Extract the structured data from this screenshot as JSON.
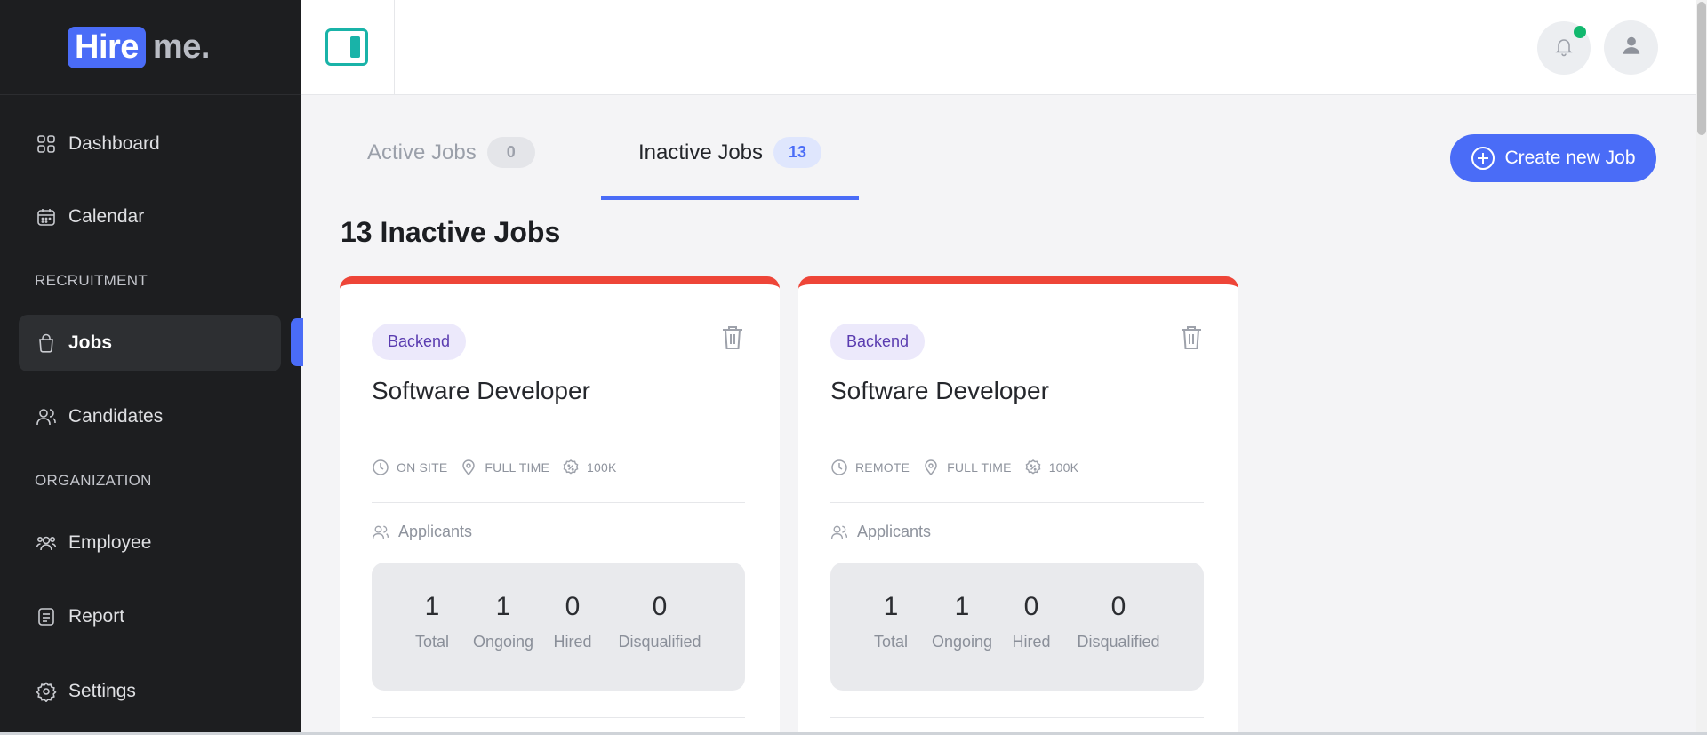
{
  "logo": {
    "part1": "Hire",
    "part2": "me."
  },
  "sidebar": {
    "items": [
      {
        "label": "Dashboard",
        "icon": "grid-icon"
      },
      {
        "label": "Calendar",
        "icon": "calendar-icon"
      },
      {
        "label": "Jobs",
        "icon": "briefcase-icon",
        "active": true
      },
      {
        "label": "Candidates",
        "icon": "users-icon"
      },
      {
        "label": "Employee",
        "icon": "employee-group-icon"
      },
      {
        "label": "Report",
        "icon": "report-icon"
      },
      {
        "label": "Settings",
        "icon": "gear-icon"
      }
    ],
    "sections": {
      "recruitment": "RECRUITMENT",
      "organization": "ORGANIZATION"
    }
  },
  "tabs": [
    {
      "label": "Active Jobs",
      "count": "0"
    },
    {
      "label": "Inactive Jobs",
      "count": "13",
      "active": true
    }
  ],
  "actions": {
    "create_label": "Create new Job"
  },
  "main": {
    "title": "13 Inactive Jobs"
  },
  "cards": [
    {
      "badge": "Backend",
      "title": "Software Developer",
      "meta": {
        "location": "ON SITE",
        "type": "FULL TIME",
        "salary": "100K"
      },
      "applicants_label": "Applicants",
      "stats": [
        {
          "value": "1",
          "label": "Total"
        },
        {
          "value": "1",
          "label": "Ongoing"
        },
        {
          "value": "0",
          "label": "Hired"
        },
        {
          "value": "0",
          "label": "Disqualified"
        }
      ]
    },
    {
      "badge": "Backend",
      "title": "Software Developer",
      "meta": {
        "location": "REMOTE",
        "type": "FULL TIME",
        "salary": "100K"
      },
      "applicants_label": "Applicants",
      "stats": [
        {
          "value": "1",
          "label": "Total"
        },
        {
          "value": "1",
          "label": "Ongoing"
        },
        {
          "value": "0",
          "label": "Hired"
        },
        {
          "value": "0",
          "label": "Disqualified"
        }
      ]
    }
  ],
  "colors": {
    "accent": "#4a6cf7",
    "sidebar_bg": "#1d1e20",
    "card_top_border": "#ee4538",
    "notification_dot": "#12b86e",
    "panel_toggle": "#19b3a8"
  }
}
